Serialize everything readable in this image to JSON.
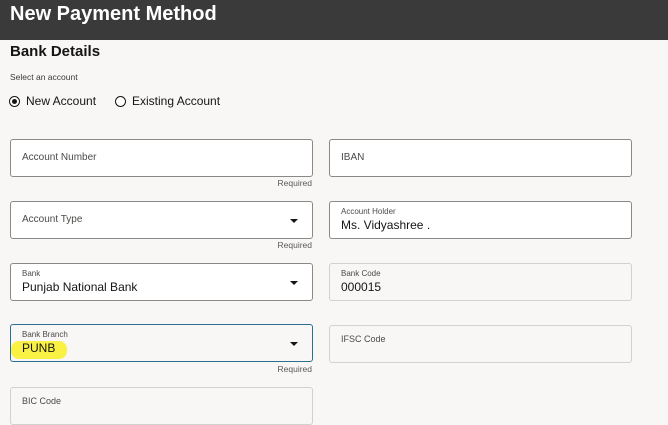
{
  "page": {
    "title": "New Payment Method"
  },
  "section": {
    "title": "Bank Details"
  },
  "account_selection": {
    "label": "Select an account",
    "options": [
      {
        "label": "New Account",
        "selected": true
      },
      {
        "label": "Existing Account",
        "selected": false
      }
    ]
  },
  "fields": {
    "account_number": {
      "label": "Account Number",
      "helper": "Required"
    },
    "iban": {
      "label": "IBAN"
    },
    "account_type": {
      "label": "Account Type",
      "helper": "Required"
    },
    "account_holder": {
      "label": "Account Holder",
      "value": "Ms. Vidyashree ."
    },
    "bank": {
      "label": "Bank",
      "value": "Punjab National Bank"
    },
    "bank_code": {
      "label": "Bank Code",
      "value": "000015"
    },
    "bank_branch": {
      "label": "Bank Branch",
      "value": "PUNB",
      "helper": "Required"
    },
    "ifsc_code": {
      "label": "IFSC Code"
    },
    "bic_code": {
      "label": "BIC Code"
    }
  },
  "colors": {
    "header_bg": "#3a3a3a",
    "page_bg": "#f8f7f6",
    "focus_border": "#2a6f8f",
    "highlight": "#f9f13a"
  },
  "icons": {
    "dropdown": "caret-down-icon"
  }
}
